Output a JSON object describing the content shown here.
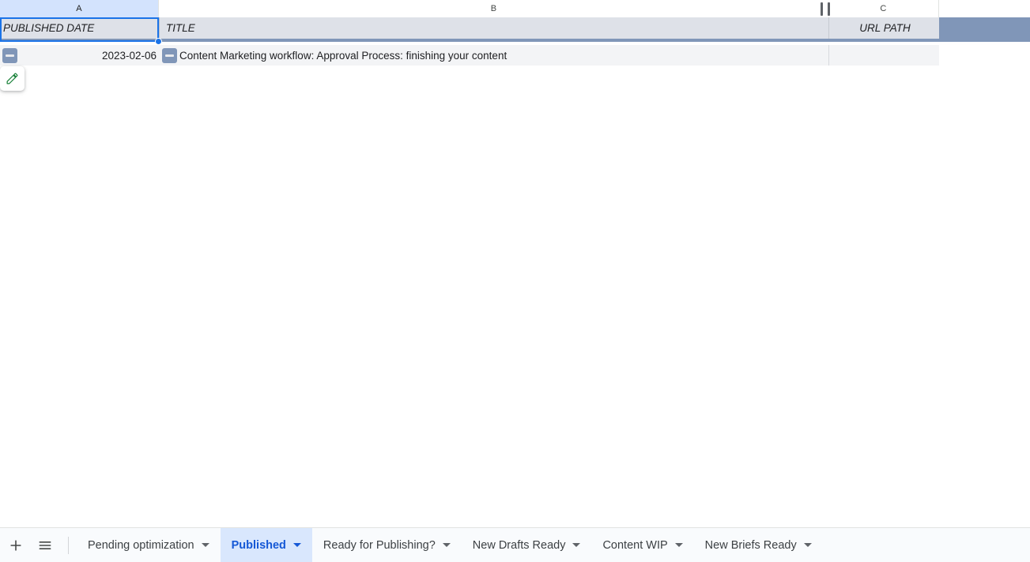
{
  "grid": {
    "column_letters": [
      "A",
      "B",
      "C",
      ""
    ],
    "selected_column": "A",
    "header_row": {
      "a": "PUBLISHED DATE",
      "b": "TITLE",
      "c": "URL PATH",
      "d": ""
    },
    "rows": [
      {
        "published_date": "2023-02-06",
        "title": "Content Marketing workflow: Approval Process: finishing your content",
        "url_path": ""
      }
    ],
    "collapse_icon": "minus-icon",
    "edit_icon": "pencil-icon",
    "frozen_divider": "freeze-grip"
  },
  "sheet_bar": {
    "add_sheet_label": "+",
    "add_sheet_icon": "plus-icon",
    "all_sheets_icon": "hamburger-menu-icon",
    "tabs": [
      {
        "label": "Pending optimization",
        "active": false
      },
      {
        "label": "Published",
        "active": true
      },
      {
        "label": "Ready for Publishing?",
        "active": false
      },
      {
        "label": "New Drafts Ready",
        "active": false
      },
      {
        "label": "Content WIP",
        "active": false
      },
      {
        "label": "New Briefs Ready",
        "active": false
      }
    ]
  },
  "colors": {
    "selected_column_header": "#d3e3fd",
    "header_row_bg": "#dee1e8",
    "header_underline": "#8096b8",
    "data_row_bg": "#f3f4f6",
    "selection_border": "#1a73e8",
    "active_tab_bg": "#d9e7fd",
    "active_tab_text": "#1558d6",
    "edit_icon_color": "#188038"
  }
}
